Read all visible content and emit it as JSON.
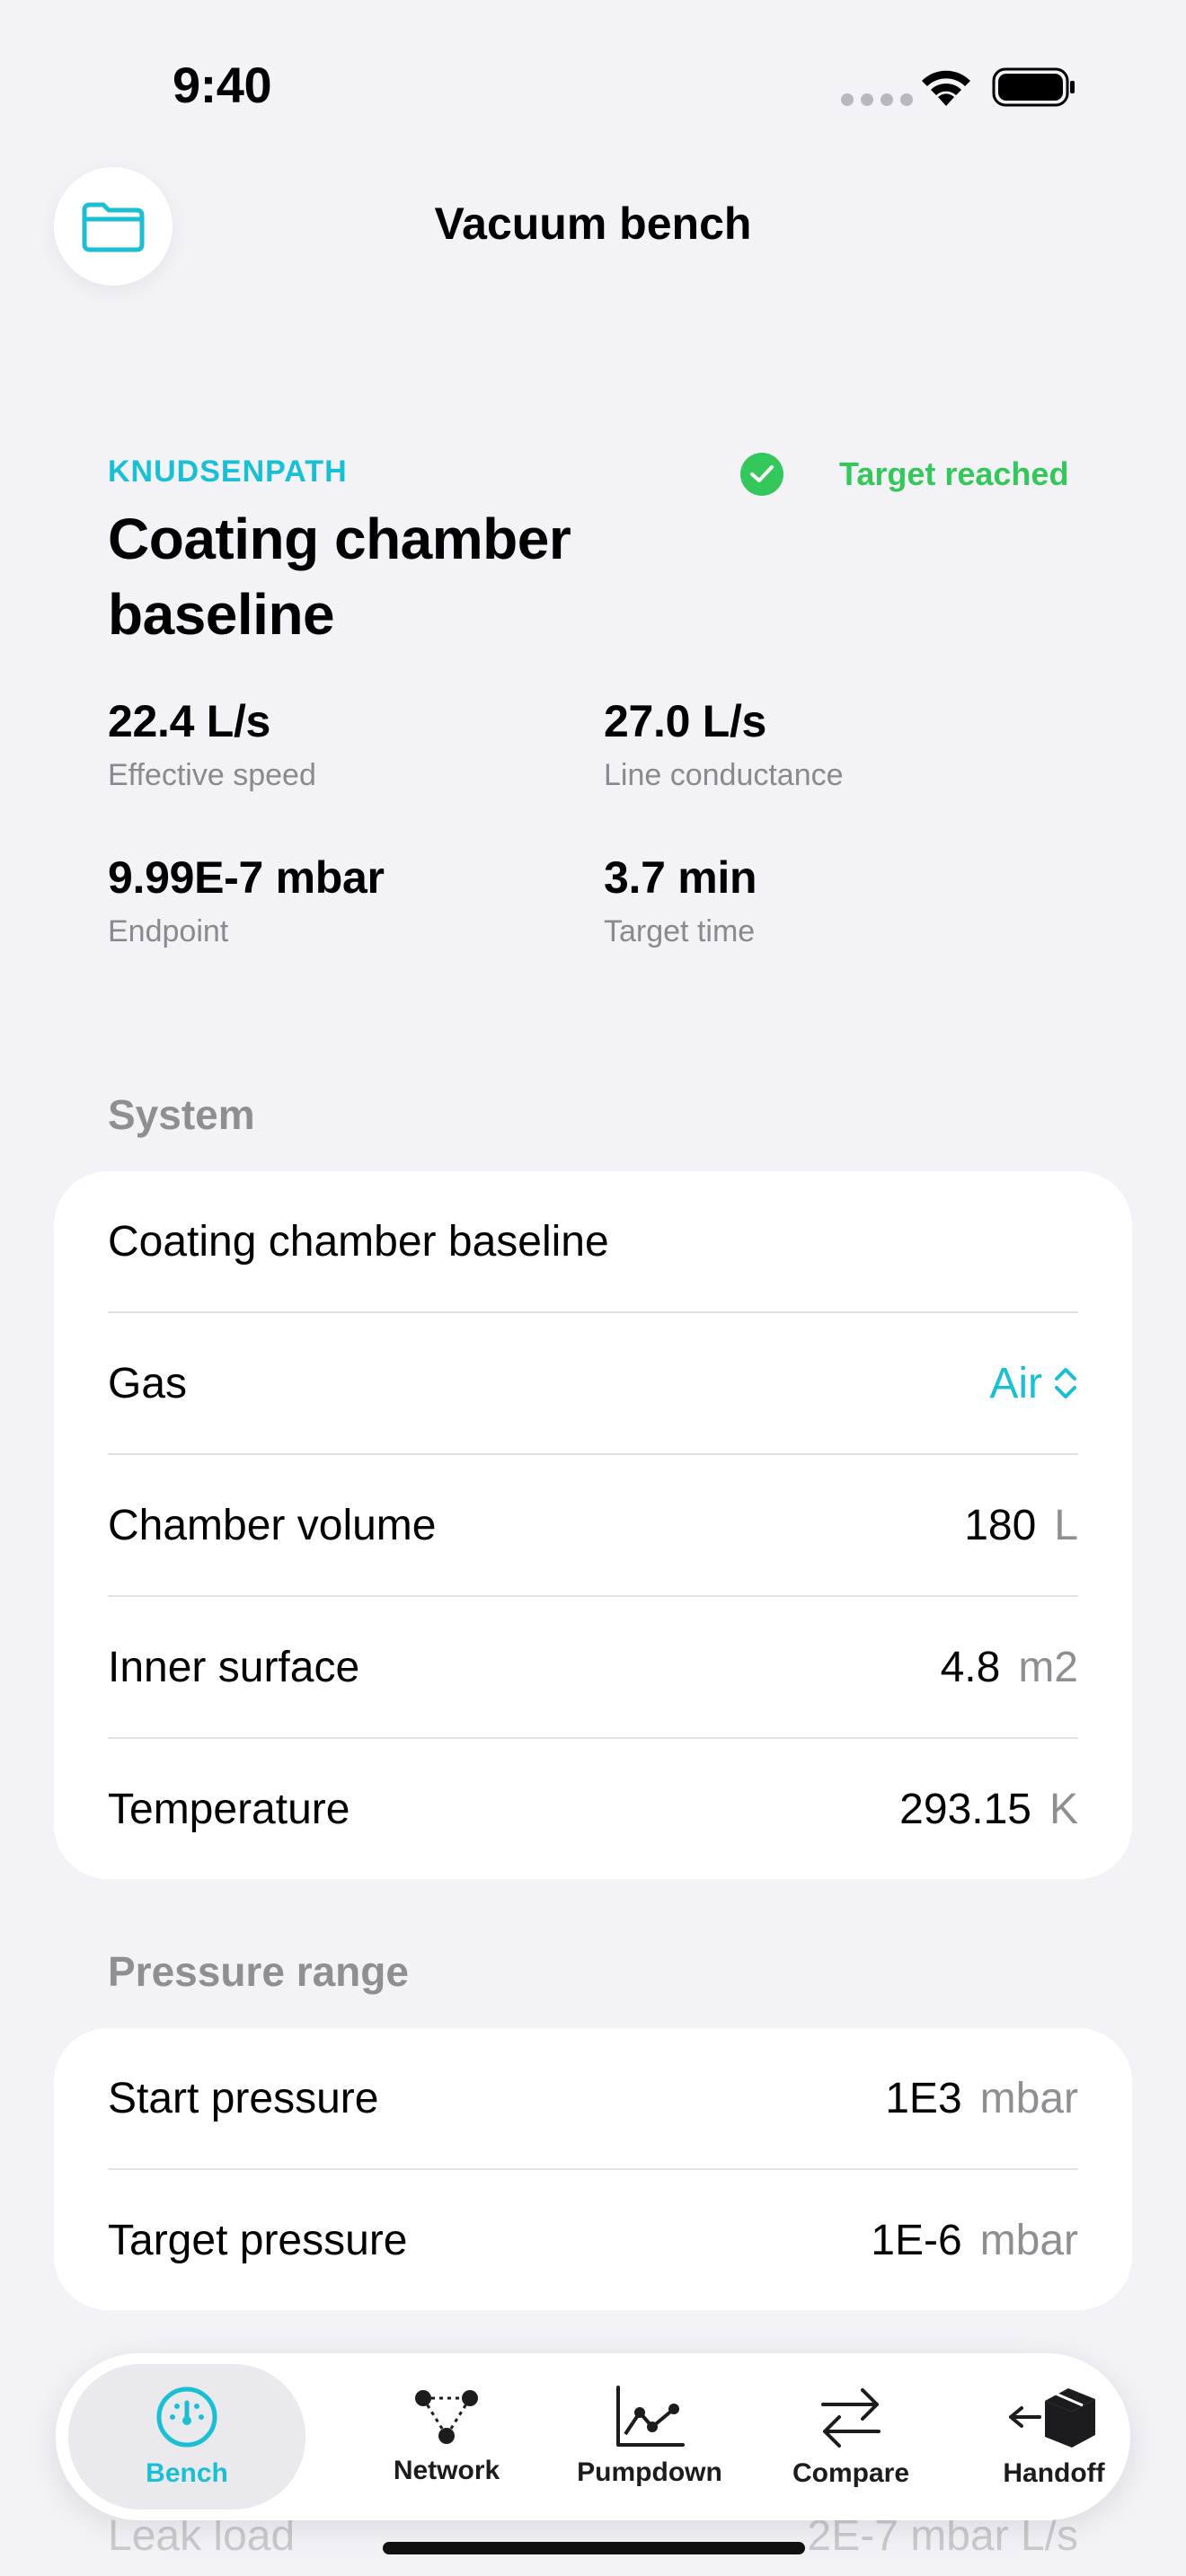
{
  "status_bar": {
    "time": "9:40"
  },
  "header": {
    "title": "Vacuum bench",
    "folder_icon": "folder-icon"
  },
  "summary": {
    "brand": "KNUDSENPATH",
    "status": "Target reached",
    "title": "Coating chamber baseline",
    "metrics": [
      {
        "value": "22.4 L/s",
        "label": "Effective speed"
      },
      {
        "value": "27.0 L/s",
        "label": "Line conductance"
      },
      {
        "value": "9.99E-7 mbar",
        "label": "Endpoint"
      },
      {
        "value": "3.7 min",
        "label": "Target time"
      }
    ]
  },
  "system": {
    "header": "System",
    "name": "Coating chamber baseline",
    "gas": {
      "label": "Gas",
      "value": "Air"
    },
    "rows": [
      {
        "label": "Chamber volume",
        "value": "180",
        "unit": "L"
      },
      {
        "label": "Inner surface",
        "value": "4.8",
        "unit": "m2"
      },
      {
        "label": "Temperature",
        "value": "293.15",
        "unit": "K"
      }
    ]
  },
  "pressure_range": {
    "header": "Pressure range",
    "rows": [
      {
        "label": "Start pressure",
        "value": "1E3",
        "unit": "mbar"
      },
      {
        "label": "Target pressure",
        "value": "1E-6",
        "unit": "mbar"
      }
    ]
  },
  "hidden_row": {
    "label": "Leak load",
    "value": "2E-7 mbar L/s"
  },
  "tabs": [
    {
      "label": "Bench",
      "icon": "gauge-icon",
      "active": true
    },
    {
      "label": "Network",
      "icon": "network-icon",
      "active": false
    },
    {
      "label": "Pumpdown",
      "icon": "chart-icon",
      "active": false
    },
    {
      "label": "Compare",
      "icon": "arrows-icon",
      "active": false
    },
    {
      "label": "Handoff",
      "icon": "box-icon",
      "active": false
    }
  ],
  "colors": {
    "accent": "#1BBFD3",
    "success": "#34C759",
    "background": "#F2F2F7",
    "secondary_text": "#8E8E93"
  }
}
